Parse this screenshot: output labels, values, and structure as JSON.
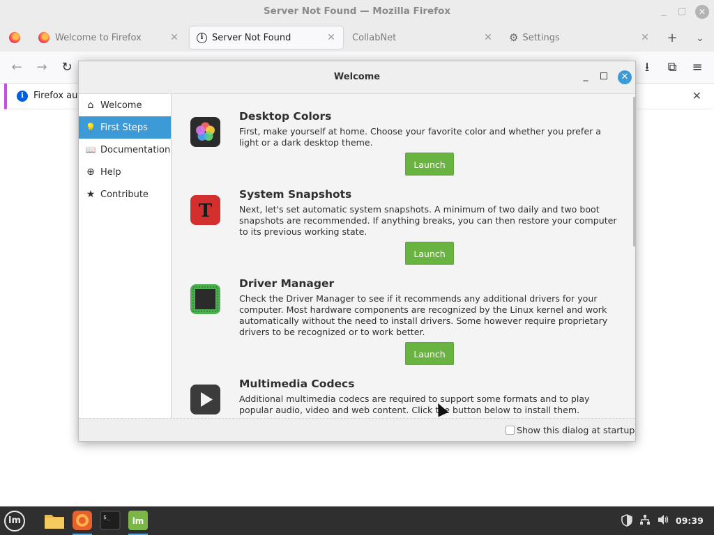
{
  "window": {
    "title": "Server Not Found — Mozilla Firefox",
    "minimize": "_",
    "maximize": "□",
    "close": "✕"
  },
  "tabs": [
    {
      "label": "Welcome to Firefox",
      "close": "✕"
    },
    {
      "label": "Server Not Found",
      "close": "✕"
    },
    {
      "label": "CollabNet",
      "close": "✕"
    },
    {
      "label": "Settings",
      "close": "✕"
    }
  ],
  "tabbar": {
    "new_tab": "+",
    "list_all": "⌄"
  },
  "nav": {
    "back": "←",
    "forward": "→",
    "reload": "↻",
    "downloads": "⭳",
    "extensions": "⧉",
    "menu": "≡"
  },
  "notification": {
    "text": "Firefox auto",
    "close": "✕"
  },
  "dialog": {
    "title": "Welcome",
    "sidebar": [
      {
        "label": "Welcome",
        "icon": "⌂"
      },
      {
        "label": "First Steps",
        "icon": "💡"
      },
      {
        "label": "Documentation",
        "icon": "📖"
      },
      {
        "label": "Help",
        "icon": "⊕"
      },
      {
        "label": "Contribute",
        "icon": "★"
      }
    ],
    "sections": [
      {
        "title": "Desktop Colors",
        "description": "First, make yourself at home. Choose your favorite color and whether you prefer a light or a dark desktop theme.",
        "button": "Launch"
      },
      {
        "title": "System Snapshots",
        "description": "Next, let's set automatic system snapshots. A minimum of two daily and two boot snapshots are recommended. If anything breaks, you can then restore your computer to its previous working state.",
        "button": "Launch"
      },
      {
        "title": "Driver Manager",
        "description": "Check the Driver Manager to see if it recommends any additional drivers for your computer. Most hardware components are recognized by the Linux kernel and work automatically without the need to install drivers. Some however require proprietary drivers to be recognized or to work better.",
        "button": "Launch"
      },
      {
        "title": "Multimedia Codecs",
        "description": "Additional multimedia codecs are required to support some formats and to play popular audio, video and web content. Click the button below to install them."
      }
    ],
    "startup_checkbox_label": "Show this dialog at startup",
    "startup_checked": false
  },
  "taskbar": {
    "menu_label": "lm",
    "clock": "09:39"
  },
  "colors": {
    "accent": "#3c9bd6",
    "launch": "#69b341",
    "taskbar": "#2f2f2f"
  }
}
